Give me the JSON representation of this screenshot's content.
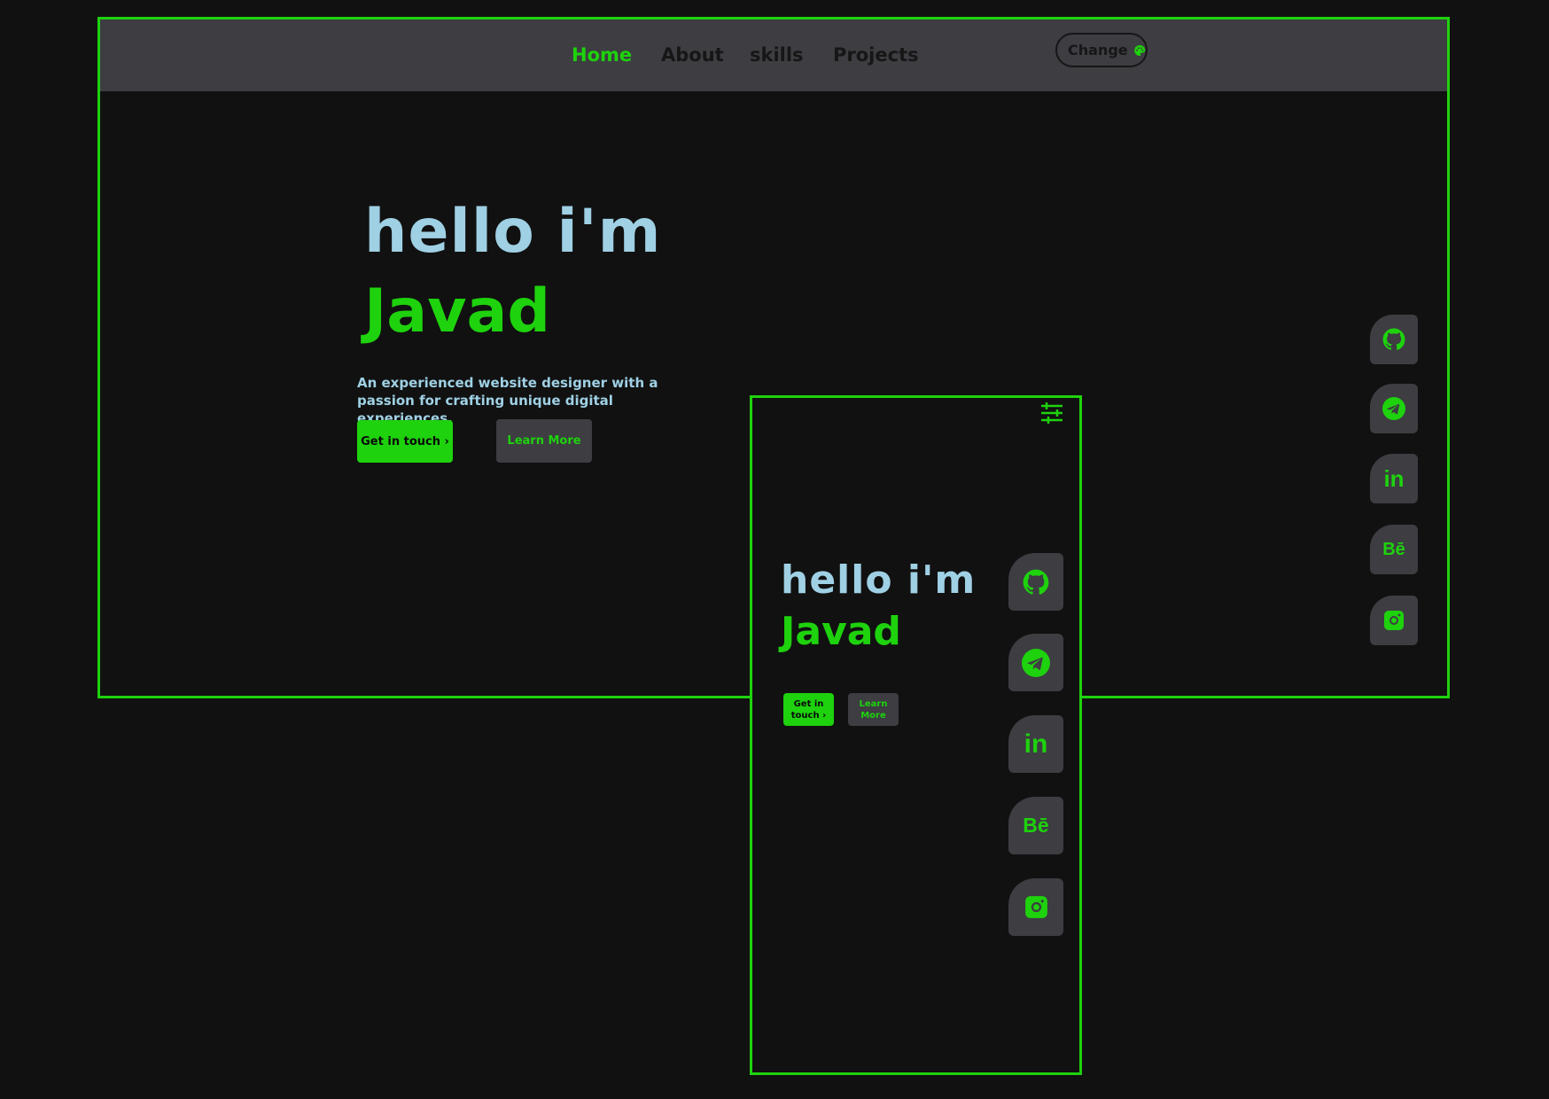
{
  "nav": {
    "items": [
      "Home",
      "About",
      "skills",
      "Projects"
    ],
    "active": "Home",
    "change_label": "Change"
  },
  "hero": {
    "greeting": "hello i'm",
    "name": "Javad",
    "description_line1": "An experienced website designer with a",
    "description_line2": "passion for crafting unique digital experiences.",
    "primary_button": "Get in touch ›",
    "secondary_button": "Learn More"
  },
  "mobile": {
    "greeting": "hello i'm",
    "name": "Javad",
    "primary_button_line1": "Get in",
    "primary_button_line2": "touch ›",
    "secondary_button_line1": "Learn",
    "secondary_button_line2": "More"
  },
  "socials": [
    {
      "name": "github-icon"
    },
    {
      "name": "telegram-icon"
    },
    {
      "name": "linkedin-icon",
      "text": "in"
    },
    {
      "name": "behance-icon",
      "text": "Bē"
    },
    {
      "name": "instagram-icon"
    }
  ],
  "colors": {
    "accent": "#1ed20d",
    "hello": "#9fd0e4",
    "background": "#111111",
    "surface": "#3d3d42"
  }
}
